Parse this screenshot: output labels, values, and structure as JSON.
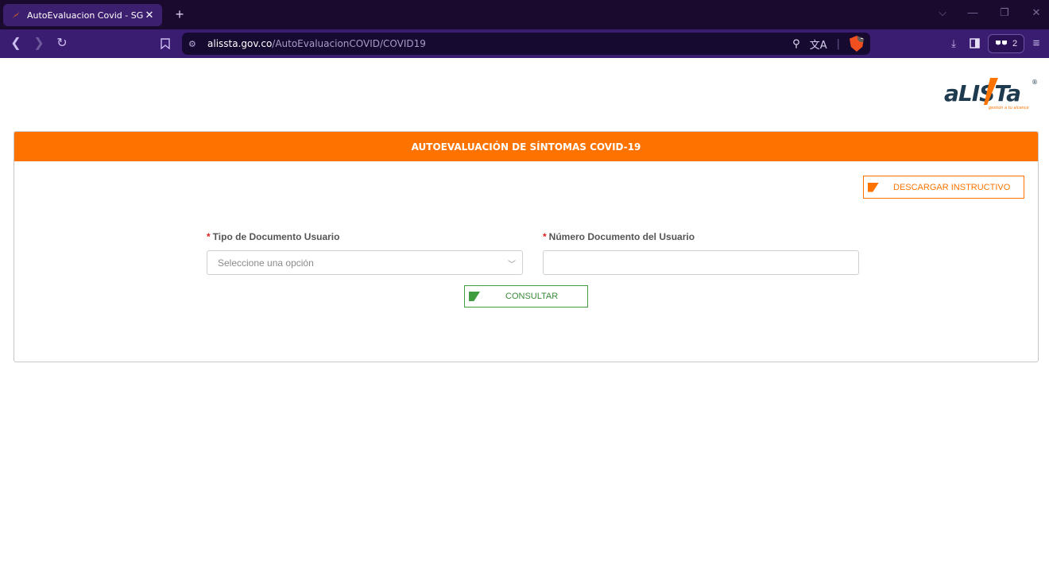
{
  "browser": {
    "tab_title": "AutoEvaluacion Covid - SGSST",
    "url_host": "alissta.gov.co",
    "url_path": "/AutoEvaluacionCOVID/COVID19",
    "profile_count": "2",
    "brave_badge": "1"
  },
  "brand": {
    "accent": "#fe7300",
    "success": "#3f9d3f",
    "logo_text": "aLISTa",
    "logo_tagline": "gestión a tu alcance",
    "logo_mark": "®"
  },
  "panel": {
    "title": "AUTOEVALUACIÓN DE SÍNTOMAS COVID-19",
    "download_label": "DESCARGAR INSTRUCTIVO"
  },
  "form": {
    "required_mark": "*",
    "doc_type_label": "Tipo de Documento Usuario",
    "doc_type_selected": "Seleccione una opción",
    "doc_number_label": "Número Documento del Usuario",
    "doc_number_value": "",
    "submit_label": "CONSULTAR"
  }
}
